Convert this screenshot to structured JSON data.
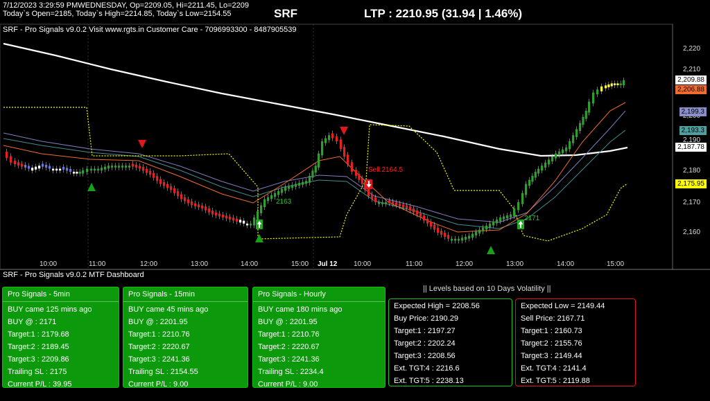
{
  "header": {
    "line1": "7/12/2023 3:29:59 PMWEDNESDAY, Op=2209.05, Hi=2211.45, Lo=2209",
    "line2": " Today`s Open=2185, Today`s High=2214.85, Today`s Low=2154.55",
    "symbol": "SRF",
    "ltp": "LTP : 2210.95 (31.94 | 1.46%)",
    "indicator": "SRF - Pro Signals v9.0.2  Visit www.rgts.in Customer Care - 7096993300 - 8487905539"
  },
  "chart_data": {
    "type": "candlestick",
    "y_ticks": [
      "2,220",
      "2,210",
      "2,200",
      "2,190",
      "2,180",
      "2,170",
      "2,160"
    ],
    "x_ticks": [
      "10:00",
      "11:00",
      "12:00",
      "13:00",
      "14:00",
      "15:00",
      "Jul 12",
      "10:00",
      "11:00",
      "12:00",
      "13:00",
      "14:00",
      "15:00"
    ],
    "price_labels": [
      {
        "text": "2,209.88",
        "color": "#ffffff"
      },
      {
        "text": "2,206.88",
        "color": "#f26d2c"
      },
      {
        "text": "2,199.3",
        "color": "#8a8ec9"
      },
      {
        "text": "2,193.3",
        "color": "#4f9fa0"
      },
      {
        "text": "2,187.78",
        "color": "#ffffff"
      },
      {
        "text": "2,175.95",
        "color": "#ffff00"
      }
    ],
    "annotations": [
      "Sell:2164.5",
      "2171",
      "2163"
    ]
  },
  "dashboard": {
    "title": "SRF - Pro Signals v9.0.2 MTF Dashboard",
    "panels": [
      {
        "title": "Pro Signals - 5min",
        "rows": [
          "BUY came 125 mins ago",
          " BUY @   : 2171",
          " Target:1 : 2179.68",
          " Target:2 : 2189.45",
          " Target:3 : 2209.86",
          " Trailing SL : 2175",
          " Current P/L : 39.95"
        ]
      },
      {
        "title": "Pro Signals - 15min",
        "rows": [
          "BUY came 45 mins ago",
          " BUY @   : 2201.95",
          " Target:1 : 2210.76",
          " Target:2 : 2220.67",
          " Target:3 : 2241.36",
          " Trailing SL : 2154.55",
          " Current P/L : 9.00"
        ]
      },
      {
        "title": "Pro Signals - Hourly",
        "rows": [
          "BUY came 180 mins ago",
          " BUY @   : 2201.95",
          " Target:1 : 2210.76",
          " Target:2 : 2220.67",
          " Target:3 : 2241.36",
          " Trailing SL : 2234.4",
          " Current P/L : 9.00"
        ]
      }
    ],
    "levels_title": "|| Levels based on 10 Days Volatility ||",
    "high_box": [
      "Expected High = 2208.56",
      "Buy Price: 2190.29",
      "Target:1 : 2197.27",
      "Target:2 : 2202.24",
      "Target:3 : 2208.56",
      "Ext. TGT:4 : 2216.6",
      "Ext. TGT:5 : 2238.13"
    ],
    "low_box": [
      "Expected Low = 2149.44",
      "Sell Price: 2167.71",
      "Target:1 : 2160.73",
      "Target:2 : 2155.76",
      "Target:3 : 2149.44",
      "Ext. TGT:4 : 2141.4",
      "Ext. TGT:5 : 2119.88"
    ]
  }
}
